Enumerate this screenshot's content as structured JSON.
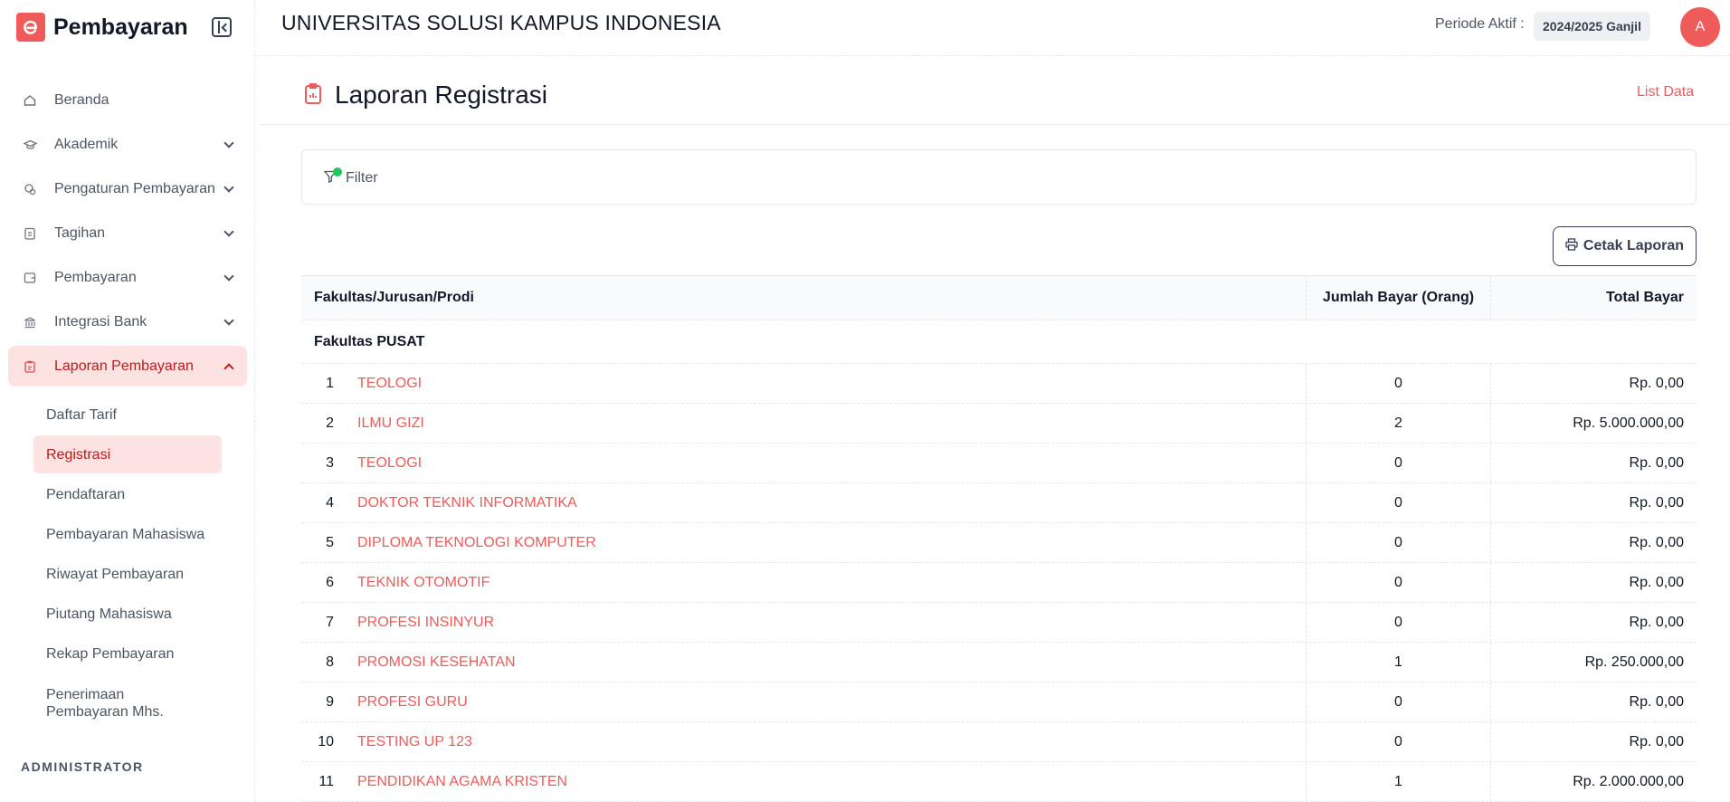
{
  "sidebar": {
    "brand_title": "Pembayaran",
    "nav": [
      {
        "label": "Beranda",
        "icon": "home-icon"
      },
      {
        "label": "Akademik",
        "icon": "graduation-cap-icon"
      },
      {
        "label": "Pengaturan Pembayaran",
        "icon": "settings-payment-icon"
      },
      {
        "label": "Tagihan",
        "icon": "bill-icon"
      },
      {
        "label": "Pembayaran",
        "icon": "wallet-icon"
      },
      {
        "label": "Integrasi Bank",
        "icon": "bank-icon"
      },
      {
        "label": "Laporan Pembayaran",
        "icon": "report-icon"
      }
    ],
    "sub_items": [
      "Daftar Tarif",
      "Registrasi",
      "Pendaftaran",
      "Pembayaran Mahasiswa",
      "Riwayat Pembayaran",
      "Piutang Mahasiswa",
      "Rekap Pembayaran",
      "Penerimaan Pembayaran Mhs."
    ],
    "section_label": "ADMINISTRATOR"
  },
  "header": {
    "university": "UNIVERSITAS SOLUSI KAMPUS INDONESIA",
    "periode_label": "Periode Aktif :",
    "periode_value": "2024/2025 Ganjil",
    "avatar_initial": "A"
  },
  "page": {
    "title": "Laporan Registrasi",
    "list_data_link": "List Data",
    "filter_label": "Filter",
    "print_button": "Cetak Laporan"
  },
  "table": {
    "columns": [
      "Fakultas/Jurusan/Prodi",
      "Jumlah Bayar (Orang)",
      "Total Bayar"
    ],
    "group": "Fakultas PUSAT",
    "rows": [
      {
        "no": "1",
        "prodi": "TEOLOGI",
        "jumlah": "0",
        "total": "Rp. 0,00"
      },
      {
        "no": "2",
        "prodi": "ILMU GIZI",
        "jumlah": "2",
        "total": "Rp. 5.000.000,00"
      },
      {
        "no": "3",
        "prodi": "TEOLOGI",
        "jumlah": "0",
        "total": "Rp. 0,00"
      },
      {
        "no": "4",
        "prodi": "DOKTOR TEKNIK INFORMATIKA",
        "jumlah": "0",
        "total": "Rp. 0,00"
      },
      {
        "no": "5",
        "prodi": "DIPLOMA TEKNOLOGI KOMPUTER",
        "jumlah": "0",
        "total": "Rp. 0,00"
      },
      {
        "no": "6",
        "prodi": "TEKNIK OTOMOTIF",
        "jumlah": "0",
        "total": "Rp. 0,00"
      },
      {
        "no": "7",
        "prodi": "PROFESI INSINYUR",
        "jumlah": "0",
        "total": "Rp. 0,00"
      },
      {
        "no": "8",
        "prodi": "PROMOSI KESEHATAN",
        "jumlah": "1",
        "total": "Rp. 250.000,00"
      },
      {
        "no": "9",
        "prodi": "PROFESI GURU",
        "jumlah": "0",
        "total": "Rp. 0,00"
      },
      {
        "no": "10",
        "prodi": "TESTING UP 123",
        "jumlah": "0",
        "total": "Rp. 0,00"
      },
      {
        "no": "11",
        "prodi": "PENDIDIKAN AGAMA KRISTEN",
        "jumlah": "1",
        "total": "Rp. 2.000.000,00"
      }
    ]
  },
  "colors": {
    "accent": "#ef5b5b",
    "active_bg": "#fde2e2",
    "active_text": "#b91c1c",
    "filter_dot": "#22c55e"
  }
}
